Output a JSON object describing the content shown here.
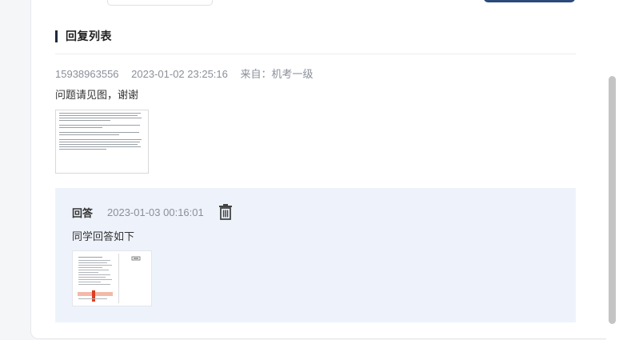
{
  "section": {
    "title": "回复列表"
  },
  "reply": {
    "user": "15938963556",
    "time": "2023-01-02 23:25:16",
    "source": "来自：机考一级",
    "content": "问题请见图，谢谢"
  },
  "answer": {
    "label": "回答",
    "time": "2023-01-03 00:16:01",
    "content": "同学回答如下"
  },
  "icons": {
    "delete": "trash-icon"
  },
  "colors": {
    "primary_button": "#2a4a7c",
    "answer_bg": "#eef3fb",
    "meta_text": "#8a8f99"
  }
}
